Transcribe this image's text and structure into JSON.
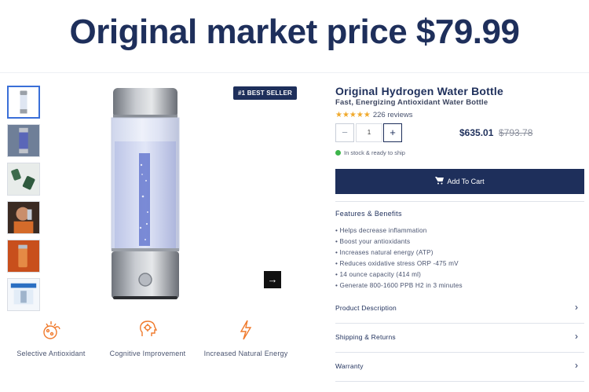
{
  "banner": {
    "text": "Original market price $79.99"
  },
  "gallery": {
    "badge": "#1 BEST SELLER",
    "next_arrow": "→",
    "thumbnails": [
      "bottle-front",
      "bottle-blue",
      "bottle-green",
      "person-drinking",
      "bottle-orange",
      "product-box"
    ]
  },
  "feature_icons": [
    {
      "icon": "antioxidant-icon",
      "label": "Selective Antioxidant"
    },
    {
      "icon": "brain-icon",
      "label": "Cognitive Improvement"
    },
    {
      "icon": "lightning-icon",
      "label": "Increased Natural Energy"
    }
  ],
  "product": {
    "title": "Original Hydrogen Water Bottle",
    "subtitle": "Fast, Energizing Antioxidant Water Bottle",
    "stars": "★★★★★",
    "rating": 4.5,
    "reviews": "226 reviews",
    "quantity": "1",
    "qty_minus": "−",
    "qty_plus": "+",
    "price": "$635.01",
    "old_price": "$793.78",
    "stock": "In stock & ready to ship",
    "add_to_cart": "Add To Cart"
  },
  "features": {
    "title": "Features & Benefits",
    "items": [
      "• Helps decrease inflammation",
      "• Boost your antioxidants",
      "• Increases natural energy (ATP)",
      "• Reduces oxidative stress ORP -475 mV",
      "• 14 ounce capacity (414 ml)",
      "• Generate 800-1600 PPB H2 in 3 minutes"
    ]
  },
  "accordions": [
    {
      "label": "Product Description",
      "chevron": "›"
    },
    {
      "label": "Shipping & Returns",
      "chevron": "›"
    },
    {
      "label": "Warranty",
      "chevron": "›"
    }
  ],
  "colors": {
    "navy": "#1e2f5b",
    "accent_orange": "#f07a2c",
    "star": "#f0a92c",
    "stock_green": "#3cb54a"
  }
}
